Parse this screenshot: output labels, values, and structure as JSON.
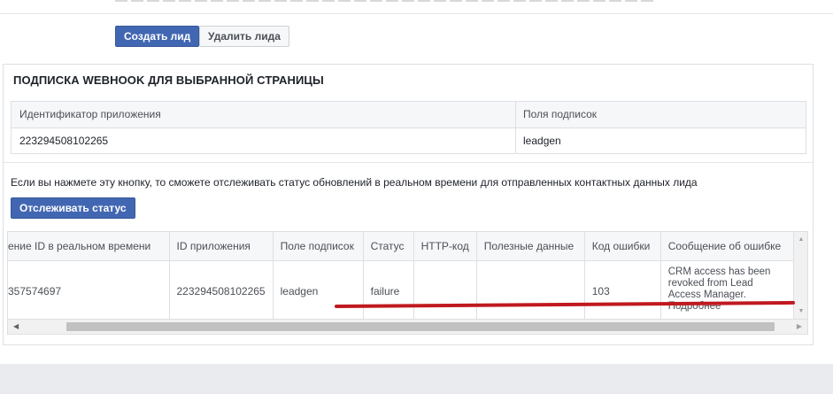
{
  "actions": {
    "create_lead": "Создать лид",
    "delete_lead": "Удалить лида"
  },
  "webhook": {
    "title": "ПОДПИСКА WEBHOOK ДЛЯ ВЫБРАННОЙ СТРАНИЦЫ",
    "columns": [
      "Идентификатор приложения",
      "Поля подписок"
    ],
    "row": [
      "223294508102265",
      "leadgen"
    ]
  },
  "status_section": {
    "help_text": "Если вы нажмете эту кнопку, то сможете отслеживать статус обновлений в реальном времени для отправленных контактных данных лида",
    "track_button": "Отслеживать статус",
    "columns": [
      "ение ID в реальном времени",
      "ID приложения",
      "Поле подписок",
      "Статус",
      "HTTP-код",
      "Полезные данные",
      "Код ошибки",
      "Сообщение об ошибке"
    ],
    "row": {
      "realtime_id": "357574697",
      "app_id": "223294508102265",
      "field": "leadgen",
      "status": "failure",
      "http_code": "",
      "payload": "",
      "error_code": "103",
      "error_message": "CRM access has been revoked from Lead Access Manager. Подробнее"
    }
  },
  "colors": {
    "primary": "#4267b2",
    "annotation_underline": "#c0191f"
  }
}
